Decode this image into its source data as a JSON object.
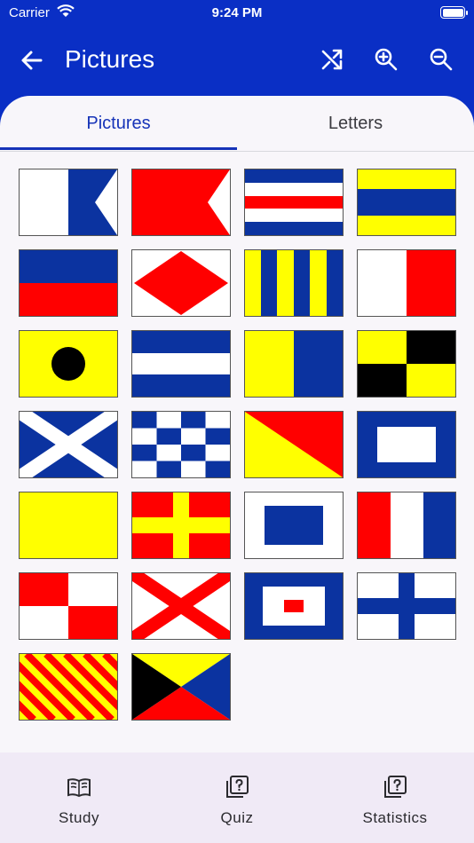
{
  "status_bar": {
    "carrier": "Carrier",
    "time": "9:24 PM"
  },
  "app_bar": {
    "title": "Pictures"
  },
  "tabs": [
    {
      "label": "Pictures",
      "selected": true
    },
    {
      "label": "Letters",
      "selected": false
    }
  ],
  "flags": [
    {
      "icon": "flag-a"
    },
    {
      "icon": "flag-b"
    },
    {
      "icon": "flag-c"
    },
    {
      "icon": "flag-d"
    },
    {
      "icon": "flag-e"
    },
    {
      "icon": "flag-f"
    },
    {
      "icon": "flag-g"
    },
    {
      "icon": "flag-h"
    },
    {
      "icon": "flag-i"
    },
    {
      "icon": "flag-j"
    },
    {
      "icon": "flag-k"
    },
    {
      "icon": "flag-l"
    },
    {
      "icon": "flag-m"
    },
    {
      "icon": "flag-n"
    },
    {
      "icon": "flag-o"
    },
    {
      "icon": "flag-p"
    },
    {
      "icon": "flag-q"
    },
    {
      "icon": "flag-r"
    },
    {
      "icon": "flag-s"
    },
    {
      "icon": "flag-t"
    },
    {
      "icon": "flag-u"
    },
    {
      "icon": "flag-v"
    },
    {
      "icon": "flag-w"
    },
    {
      "icon": "flag-x"
    },
    {
      "icon": "flag-y"
    },
    {
      "icon": "flag-z"
    }
  ],
  "bottom_nav": [
    {
      "label": "Study",
      "icon": "book-icon"
    },
    {
      "label": "Quiz",
      "icon": "quiz-icon"
    },
    {
      "label": "Statistics",
      "icon": "statistics-icon"
    }
  ],
  "colors": {
    "primary": "#0a2fc5",
    "flag_blue": "#0b33a0",
    "flag_red": "#ff0000",
    "flag_yellow": "#ffff00"
  }
}
